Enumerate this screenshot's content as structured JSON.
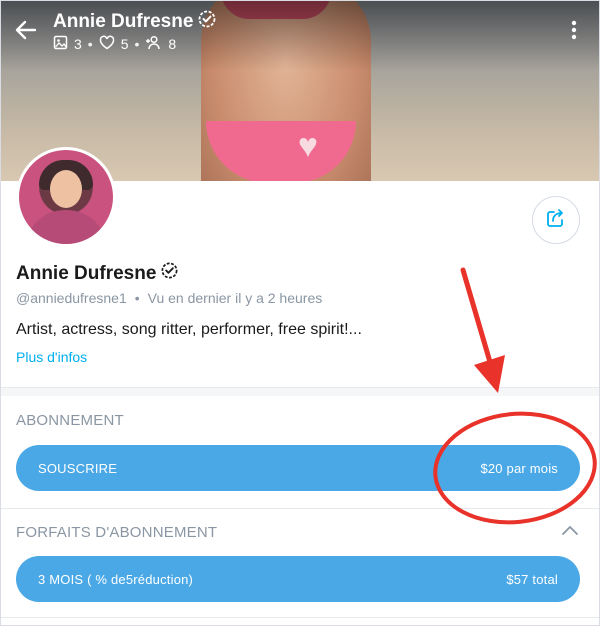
{
  "header": {
    "name": "Annie Dufresne",
    "stats": {
      "photos": "3",
      "likes": "5",
      "fans": "8",
      "separator": "•"
    }
  },
  "profile": {
    "name": "Annie Dufresne",
    "handle": "@anniedufresne1",
    "meta_separator": "•",
    "last_seen": "Vu en dernier il y a 2 heures",
    "bio": "Artist, actress, song ritter, performer, free spirit!...",
    "more_link": "Plus d'infos"
  },
  "subscription": {
    "section_title": "ABONNEMENT",
    "subscribe_label": "SOUSCRIRE",
    "price_label": "$20 par mois"
  },
  "bundles": {
    "section_title": "FORFAITS D'ABONNEMENT",
    "items": [
      {
        "label": "3 MOIS ( % de5réduction)",
        "price": "$57 total"
      }
    ]
  },
  "colors": {
    "accent": "#00aff0",
    "button": "#4aa8e6",
    "annotation": "#e8322a",
    "muted": "#8a96a3"
  }
}
